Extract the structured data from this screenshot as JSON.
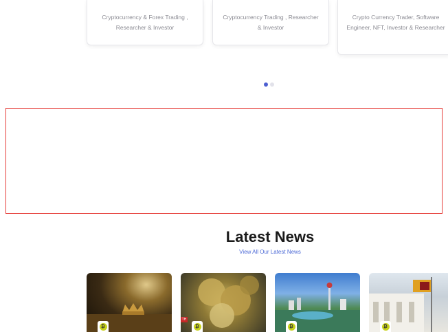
{
  "profiles": [
    {
      "role": "Cryptocurrency & Forex Trading , Researcher & Investor"
    },
    {
      "role": "Cryptocurrency Trading , Researcher & Investor"
    },
    {
      "role": "Crypto Currency Trader, Software Engineer, NFT, Investor & Researcher"
    }
  ],
  "carousel": {
    "dots": 2,
    "active": 0
  },
  "news": {
    "title": "Latest News",
    "view_all": "View All Our Latest News",
    "cards": [
      {
        "image": "crown-on-table"
      },
      {
        "image": "bitcoin-coins",
        "tag": "TH"
      },
      {
        "image": "city-skyline"
      },
      {
        "image": "flag-building"
      }
    ]
  },
  "colors": {
    "accent": "#4d5fd1",
    "link": "#4d6ad6",
    "box_border": "#e53935",
    "badge": "#c8d21c"
  }
}
